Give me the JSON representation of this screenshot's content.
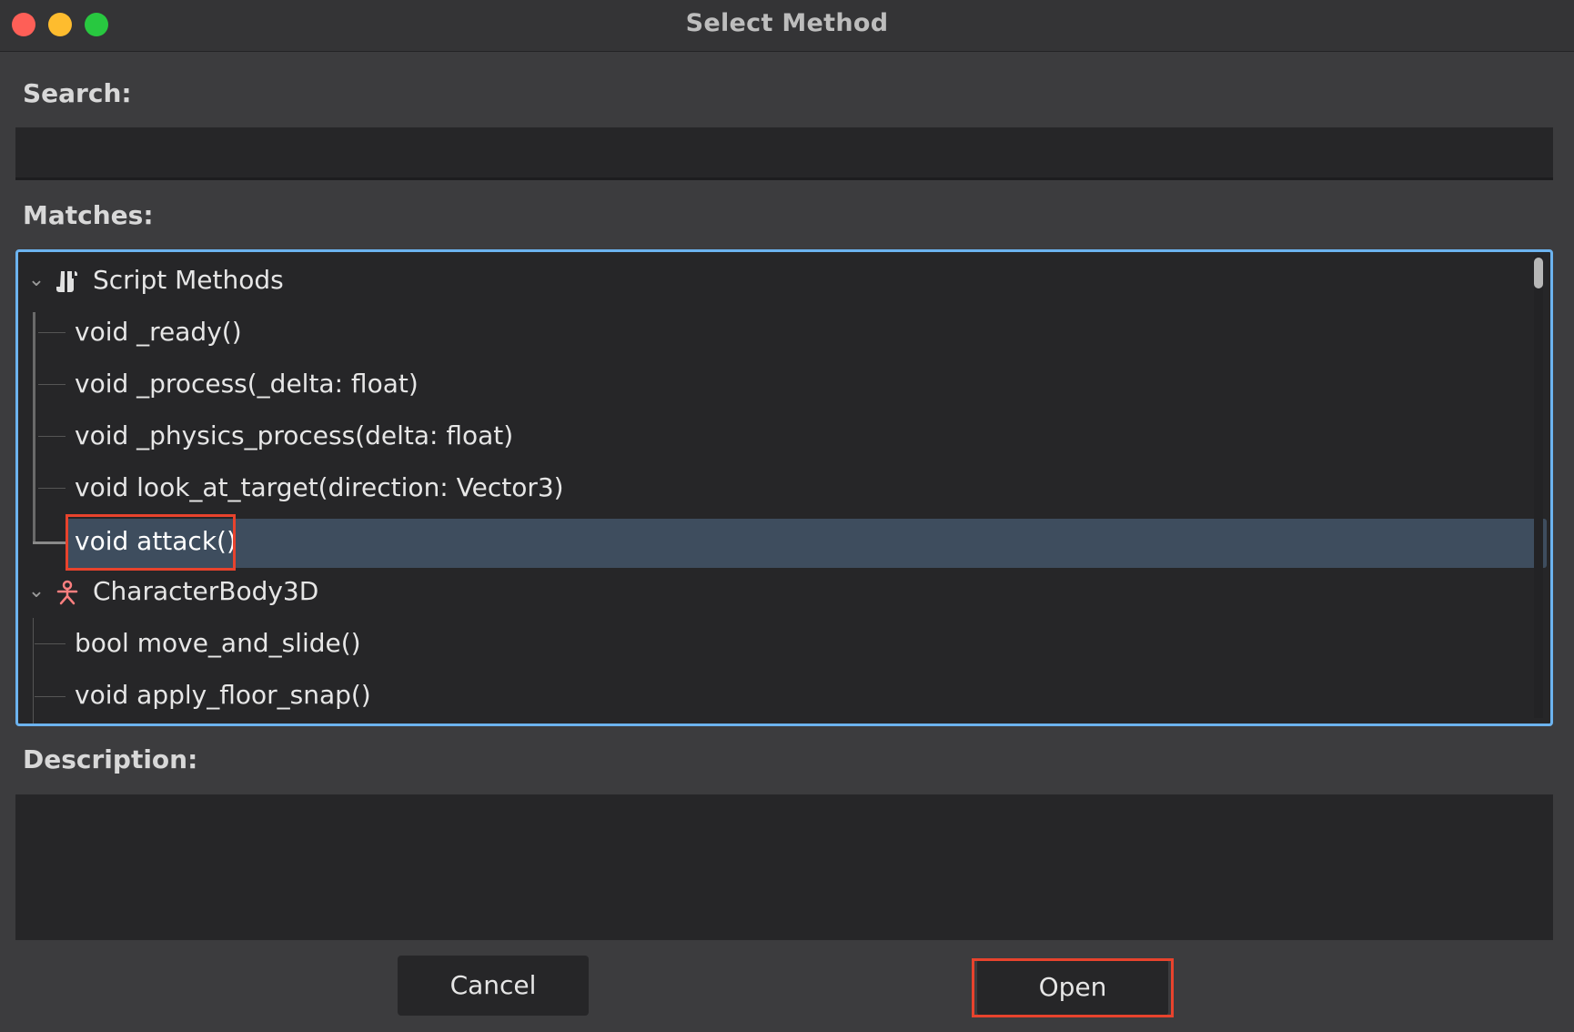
{
  "window": {
    "title": "Select Method"
  },
  "search": {
    "label": "Search:",
    "value": "",
    "placeholder": ""
  },
  "matches": {
    "label": "Matches:",
    "groups": [
      {
        "label": "Script Methods",
        "icon": "script-icon",
        "items": [
          "void _ready()",
          "void _process(_delta: float)",
          "void _physics_process(delta: float)",
          "void look_at_target(direction: Vector3)",
          "void attack()"
        ]
      },
      {
        "label": "CharacterBody3D",
        "icon": "character-body-3d-icon",
        "items": [
          "bool move_and_slide()",
          "void apply_floor_snap()"
        ]
      }
    ],
    "selected": "void attack()"
  },
  "description": {
    "label": "Description:",
    "text": ""
  },
  "buttons": {
    "cancel": "Cancel",
    "open": "Open"
  },
  "colors": {
    "accent": "#6cb3ef",
    "selection": "#3e4d5e",
    "highlight": "#e8432d",
    "node_icon": "#fc7f7f"
  }
}
